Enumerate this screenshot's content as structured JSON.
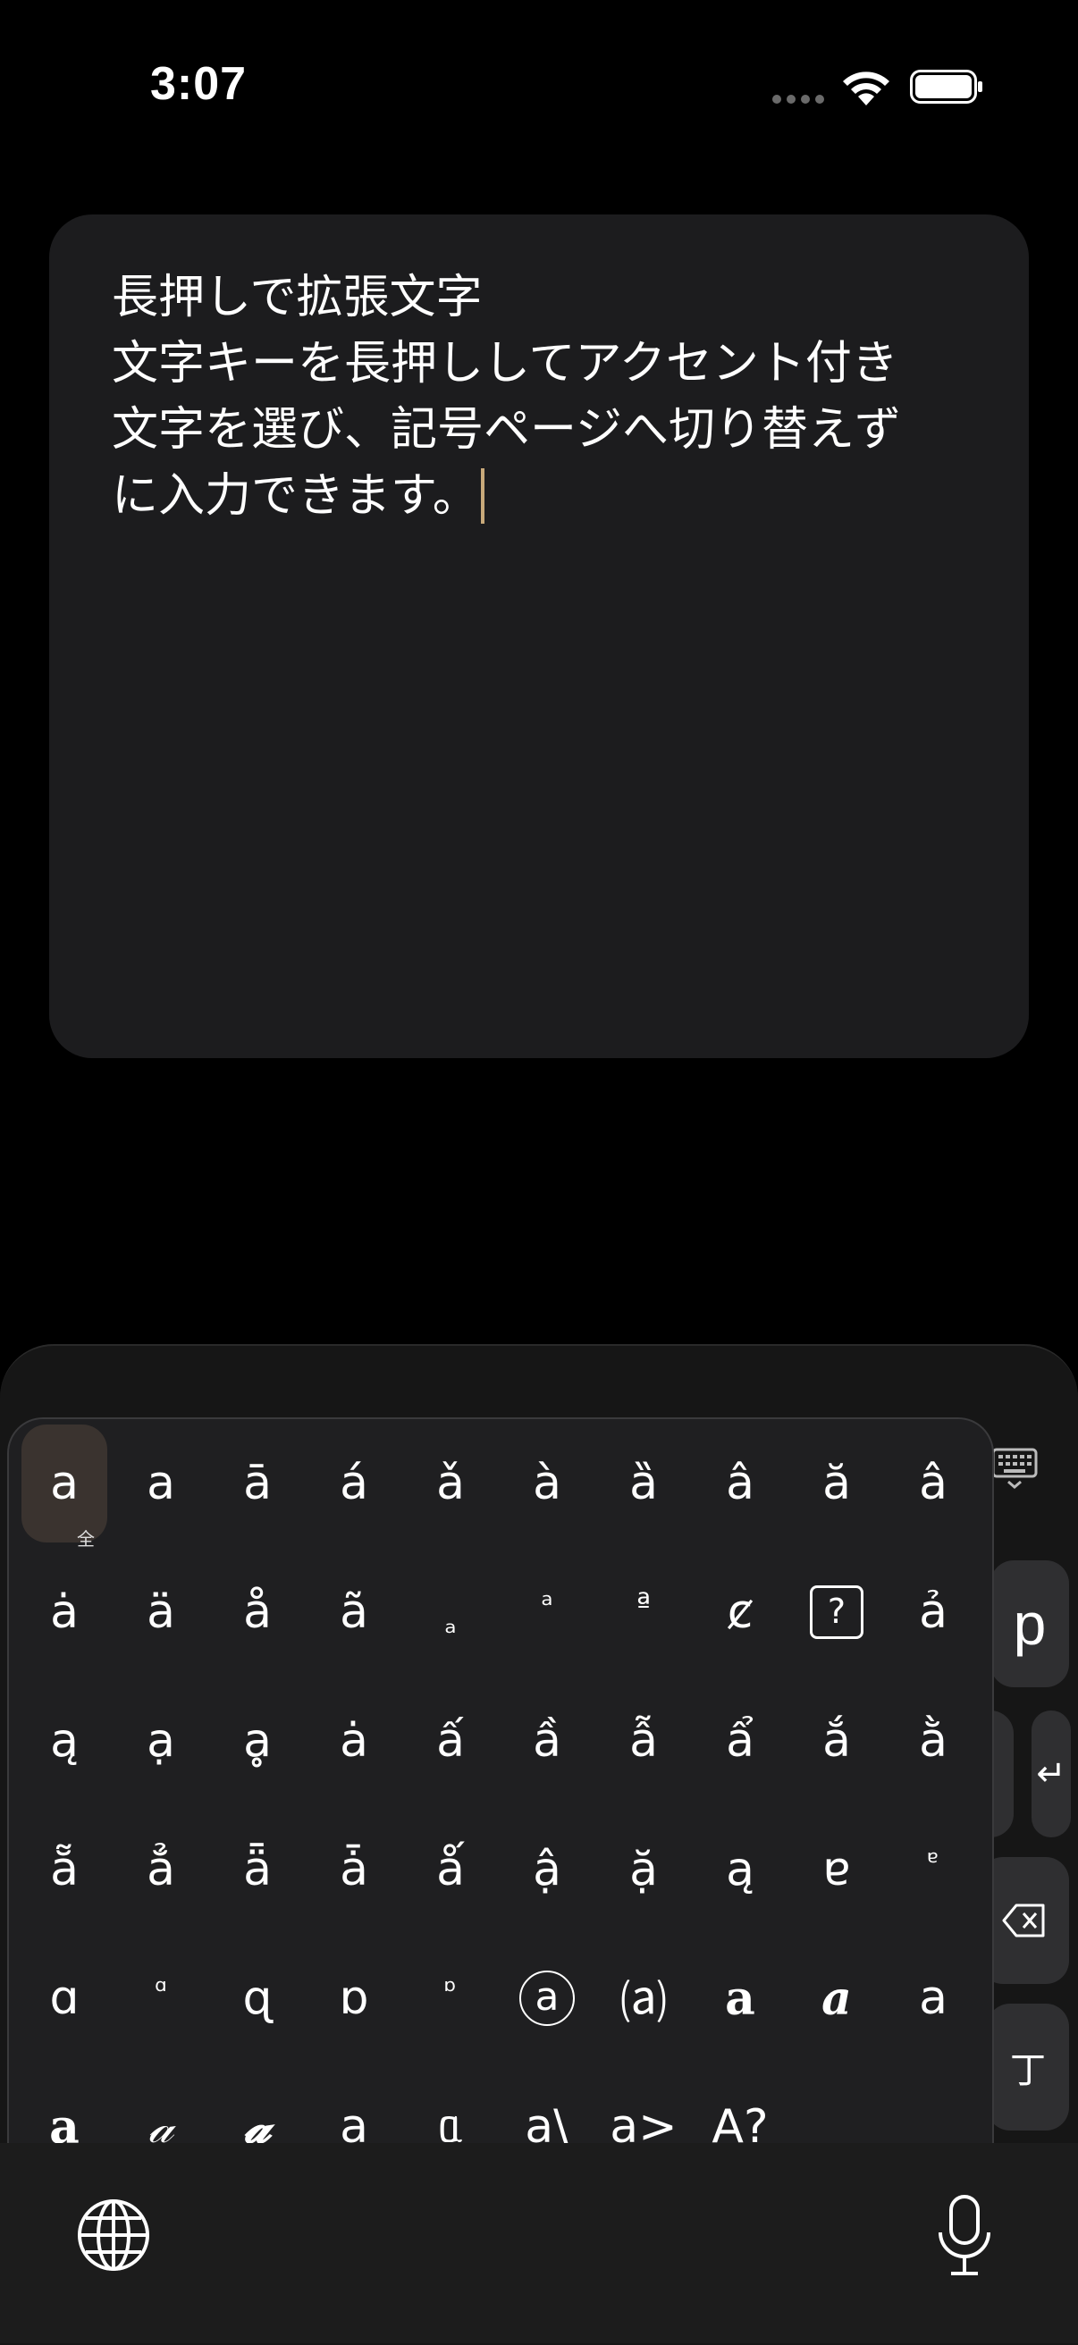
{
  "status_bar": {
    "time": "3:07"
  },
  "editor": {
    "text": "長押しで拡張文字\n文字キーを長押ししてアクセント付き\n文字を選び、記号ページへ切り替えず\nに入力できます。"
  },
  "accent_popup": {
    "selected_index": 0,
    "selected_badge": "全",
    "chars": [
      "a",
      "a",
      "ā",
      "á",
      "ǎ",
      "à",
      "ȁ",
      "â",
      "ă",
      "â",
      "ȧ",
      "ä",
      "å",
      "ã",
      "ₐ",
      "ᵃ",
      "ª",
      "ȼ",
      "?",
      "ả",
      "ą",
      "ạ",
      "ḁ",
      "ȧ",
      "ấ",
      "ầ",
      "ẫ",
      "ẩ",
      "ắ",
      "ằ",
      "ẵ",
      "ẳ",
      "ǟ",
      "ǡ",
      "ǻ",
      "ậ",
      "ặ",
      "ą",
      "ɐ",
      "ᵄ",
      "ɑ",
      "ᵅ",
      "ɋ",
      "ɒ",
      "ᶛ",
      "ⓐ",
      "⒜",
      "𝐚",
      "𝒂",
      "a",
      "𝐚",
      "𝒶",
      "𝓪",
      "а",
      "ᥲ",
      "a\\",
      "a>",
      "A?"
    ]
  },
  "keyboard": {
    "side_p": "p",
    "side_gyo": "丁",
    "side_return": "↵"
  },
  "icons": {
    "wifi": "wifi-icon",
    "battery": "battery-icon",
    "globe": "globe-icon",
    "mic": "microphone-icon",
    "keyboard": "keyboard-icon",
    "delete": "delete-icon"
  }
}
